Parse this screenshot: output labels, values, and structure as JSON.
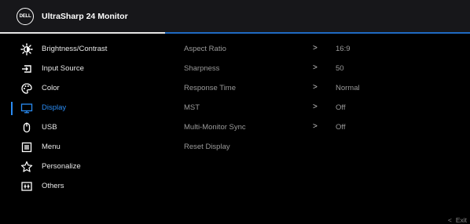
{
  "header": {
    "title": "UltraSharp 24 Monitor",
    "logo_text": "DELL"
  },
  "menu": {
    "items": [
      {
        "label": "Brightness/Contrast",
        "icon": "brightness-icon"
      },
      {
        "label": "Input Source",
        "icon": "input-source-icon"
      },
      {
        "label": "Color",
        "icon": "color-icon"
      },
      {
        "label": "Display",
        "icon": "display-icon",
        "active": true
      },
      {
        "label": "USB",
        "icon": "usb-icon"
      },
      {
        "label": "Menu",
        "icon": "menu-icon"
      },
      {
        "label": "Personalize",
        "icon": "star-icon"
      },
      {
        "label": "Others",
        "icon": "others-icon"
      }
    ]
  },
  "submenu": {
    "items": [
      {
        "label": "Aspect Ratio",
        "arrow": ">",
        "value": "16:9"
      },
      {
        "label": "Sharpness",
        "arrow": ">",
        "value": "50"
      },
      {
        "label": "Response Time",
        "arrow": ">",
        "value": "Normal"
      },
      {
        "label": "MST",
        "arrow": ">",
        "value": "Off"
      },
      {
        "label": "Multi-Monitor Sync",
        "arrow": ">",
        "value": "Off"
      },
      {
        "label": "Reset Display",
        "arrow": "",
        "value": ""
      }
    ]
  },
  "footer": {
    "exit_chevron": "<",
    "exit_label": "Exit"
  },
  "colors": {
    "accent": "#2a8cf4",
    "header_bg": "#17171a",
    "bg": "#000000"
  }
}
